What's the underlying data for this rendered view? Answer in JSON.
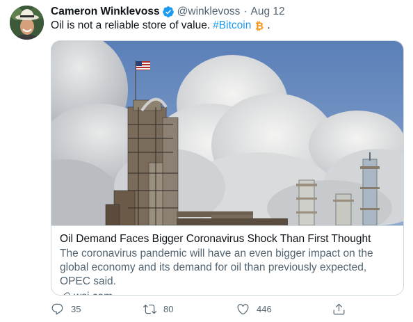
{
  "tweet": {
    "author": {
      "display_name": "Cameron Winklevoss",
      "handle": "@winklevoss",
      "date": "Aug 12",
      "separator": "·"
    },
    "text": {
      "main": "Oil is not a reliable store of value.",
      "hashtag": "#Bitcoin",
      "trailing": "."
    },
    "card": {
      "title": "Oil Demand Faces Bigger Coronavirus Shock Than First Thought",
      "description": "The coronavirus pandemic will have an even bigger impact on the global economy and its demand for oil than previously expected, OPEC said.",
      "domain": "wsj.com"
    },
    "actions": {
      "replies": "35",
      "retweets": "80",
      "likes": "446"
    }
  },
  "colors": {
    "link_blue": "#1d9bf0",
    "secondary_text": "#536471",
    "border": "#cfd9de",
    "bitcoin_orange": "#f7931a"
  },
  "icons": {
    "verified": "verified-badge-icon",
    "bitcoin": "bitcoin-icon",
    "link": "link-icon",
    "reply": "reply-icon",
    "retweet": "retweet-icon",
    "like": "heart-icon",
    "share": "share-icon"
  }
}
